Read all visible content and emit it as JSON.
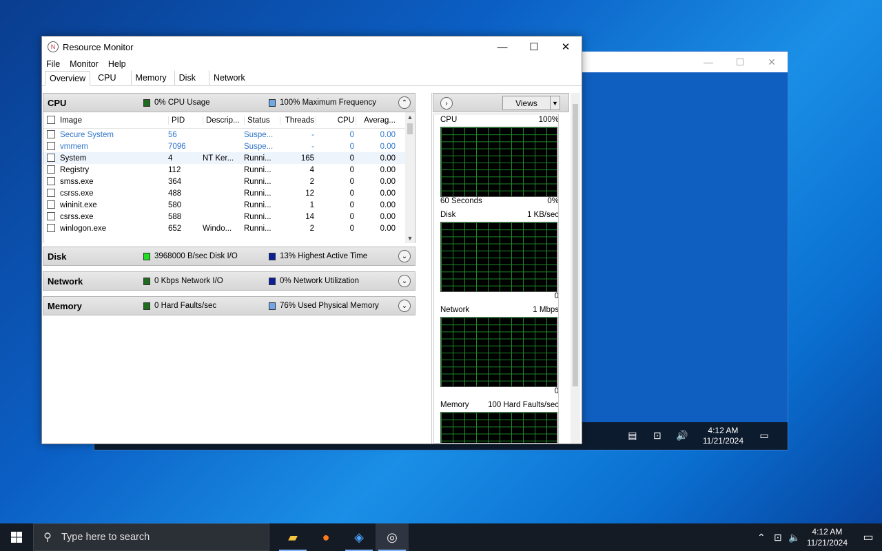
{
  "window": {
    "title": "Resource Monitor",
    "controls": {
      "minimize": "—",
      "maximize": "☐",
      "close": "✕"
    }
  },
  "menu": [
    "File",
    "Monitor",
    "Help"
  ],
  "tabs": [
    "Overview",
    "CPU",
    "Memory",
    "Disk",
    "Network"
  ],
  "cpu_section": {
    "title": "CPU",
    "legend1": "0% CPU Usage",
    "legend2": "100% Maximum Frequency",
    "columns": [
      "Image",
      "PID",
      "Descrip...",
      "Status",
      "Threads",
      "CPU",
      "Averag..."
    ],
    "rows": [
      {
        "image": "Secure System",
        "pid": "56",
        "desc": "",
        "status": "Suspe...",
        "threads": "-",
        "cpu": "0",
        "avg": "0.00"
      },
      {
        "image": "vmmem",
        "pid": "7096",
        "desc": "",
        "status": "Suspe...",
        "threads": "-",
        "cpu": "0",
        "avg": "0.00"
      },
      {
        "image": "System",
        "pid": "4",
        "desc": "NT Ker...",
        "status": "Runni...",
        "threads": "165",
        "cpu": "0",
        "avg": "0.00"
      },
      {
        "image": "Registry",
        "pid": "112",
        "desc": "",
        "status": "Runni...",
        "threads": "4",
        "cpu": "0",
        "avg": "0.00"
      },
      {
        "image": "smss.exe",
        "pid": "364",
        "desc": "",
        "status": "Runni...",
        "threads": "2",
        "cpu": "0",
        "avg": "0.00"
      },
      {
        "image": "csrss.exe",
        "pid": "488",
        "desc": "",
        "status": "Runni...",
        "threads": "12",
        "cpu": "0",
        "avg": "0.00"
      },
      {
        "image": "wininit.exe",
        "pid": "580",
        "desc": "",
        "status": "Runni...",
        "threads": "1",
        "cpu": "0",
        "avg": "0.00"
      },
      {
        "image": "csrss.exe",
        "pid": "588",
        "desc": "",
        "status": "Runni...",
        "threads": "14",
        "cpu": "0",
        "avg": "0.00"
      },
      {
        "image": "winlogon.exe",
        "pid": "652",
        "desc": "Windo...",
        "status": "Runni...",
        "threads": "2",
        "cpu": "0",
        "avg": "0.00"
      }
    ]
  },
  "disk_section": {
    "title": "Disk",
    "legend1": "3968000 B/sec Disk I/O",
    "legend2": "13% Highest Active Time"
  },
  "network_section": {
    "title": "Network",
    "legend1": "0 Kbps Network I/O",
    "legend2": "0% Network Utilization"
  },
  "memory_section": {
    "title": "Memory",
    "legend1": "0 Hard Faults/sec",
    "legend2": "76% Used Physical Memory"
  },
  "right_pane": {
    "views_label": "Views",
    "graphs": [
      {
        "name": "CPU",
        "max": "100%",
        "foot_left": "60 Seconds",
        "foot_right": "0%"
      },
      {
        "name": "Disk",
        "max": "1 KB/sec",
        "foot_left": "",
        "foot_right": "0"
      },
      {
        "name": "Network",
        "max": "1 Mbps",
        "foot_left": "",
        "foot_right": "0"
      },
      {
        "name": "Memory",
        "max": "100 Hard Faults/sec",
        "foot_left": "",
        "foot_right": ""
      }
    ]
  },
  "inner_vm": {
    "time": "4:12 AM",
    "date": "11/21/2024"
  },
  "taskbar": {
    "search_placeholder": "Type here to search",
    "time": "4:12 AM",
    "date": "11/21/2024"
  },
  "colors": {
    "cpu_usage": "#1f6b1f",
    "cpu_freq": "#6fa8e8",
    "disk_io": "#22dd22",
    "disk_active": "#0b1e9e",
    "net_io": "#1f6b1f",
    "net_util": "#0b1e9e",
    "mem_faults": "#1f6b1f",
    "mem_used": "#6fa8e8"
  }
}
